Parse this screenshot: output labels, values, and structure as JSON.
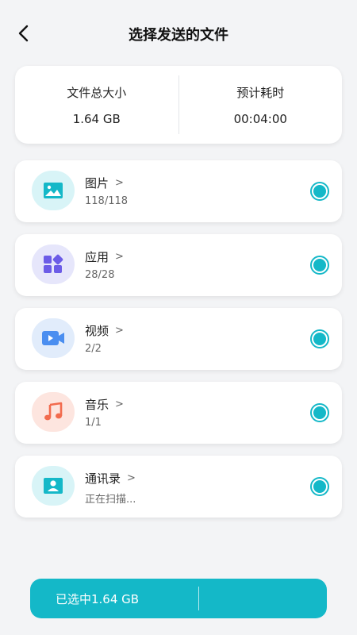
{
  "header": {
    "title": "选择发送的文件"
  },
  "summary": {
    "size_label": "文件总大小",
    "size_value": "1.64 GB",
    "time_label": "预计耗时",
    "time_value": "00:04:00"
  },
  "categories": [
    {
      "name": "图片",
      "count": "118/118",
      "icon": "image-icon",
      "icon_bg": "#d8f4f7",
      "icon_color": "#14b8c8",
      "selected": true
    },
    {
      "name": "应用",
      "count": "28/28",
      "icon": "apps-icon",
      "icon_bg": "#e6e6fb",
      "icon_color": "#6c5ce7",
      "selected": true
    },
    {
      "name": "视频",
      "count": "2/2",
      "icon": "video-icon",
      "icon_bg": "#e1ecfb",
      "icon_color": "#4a8ef0",
      "selected": true
    },
    {
      "name": "音乐",
      "count": "1/1",
      "icon": "music-icon",
      "icon_bg": "#fde5df",
      "icon_color": "#f26b4e",
      "selected": true
    },
    {
      "name": "通讯录",
      "count": "正在扫描...",
      "icon": "contacts-icon",
      "icon_bg": "#d8f4f7",
      "icon_color": "#14b8c8",
      "selected": true
    }
  ],
  "footer": {
    "selected_label": "已选中1.64 GB"
  },
  "colors": {
    "accent": "#14b8c8",
    "background": "#f3f4f6"
  }
}
